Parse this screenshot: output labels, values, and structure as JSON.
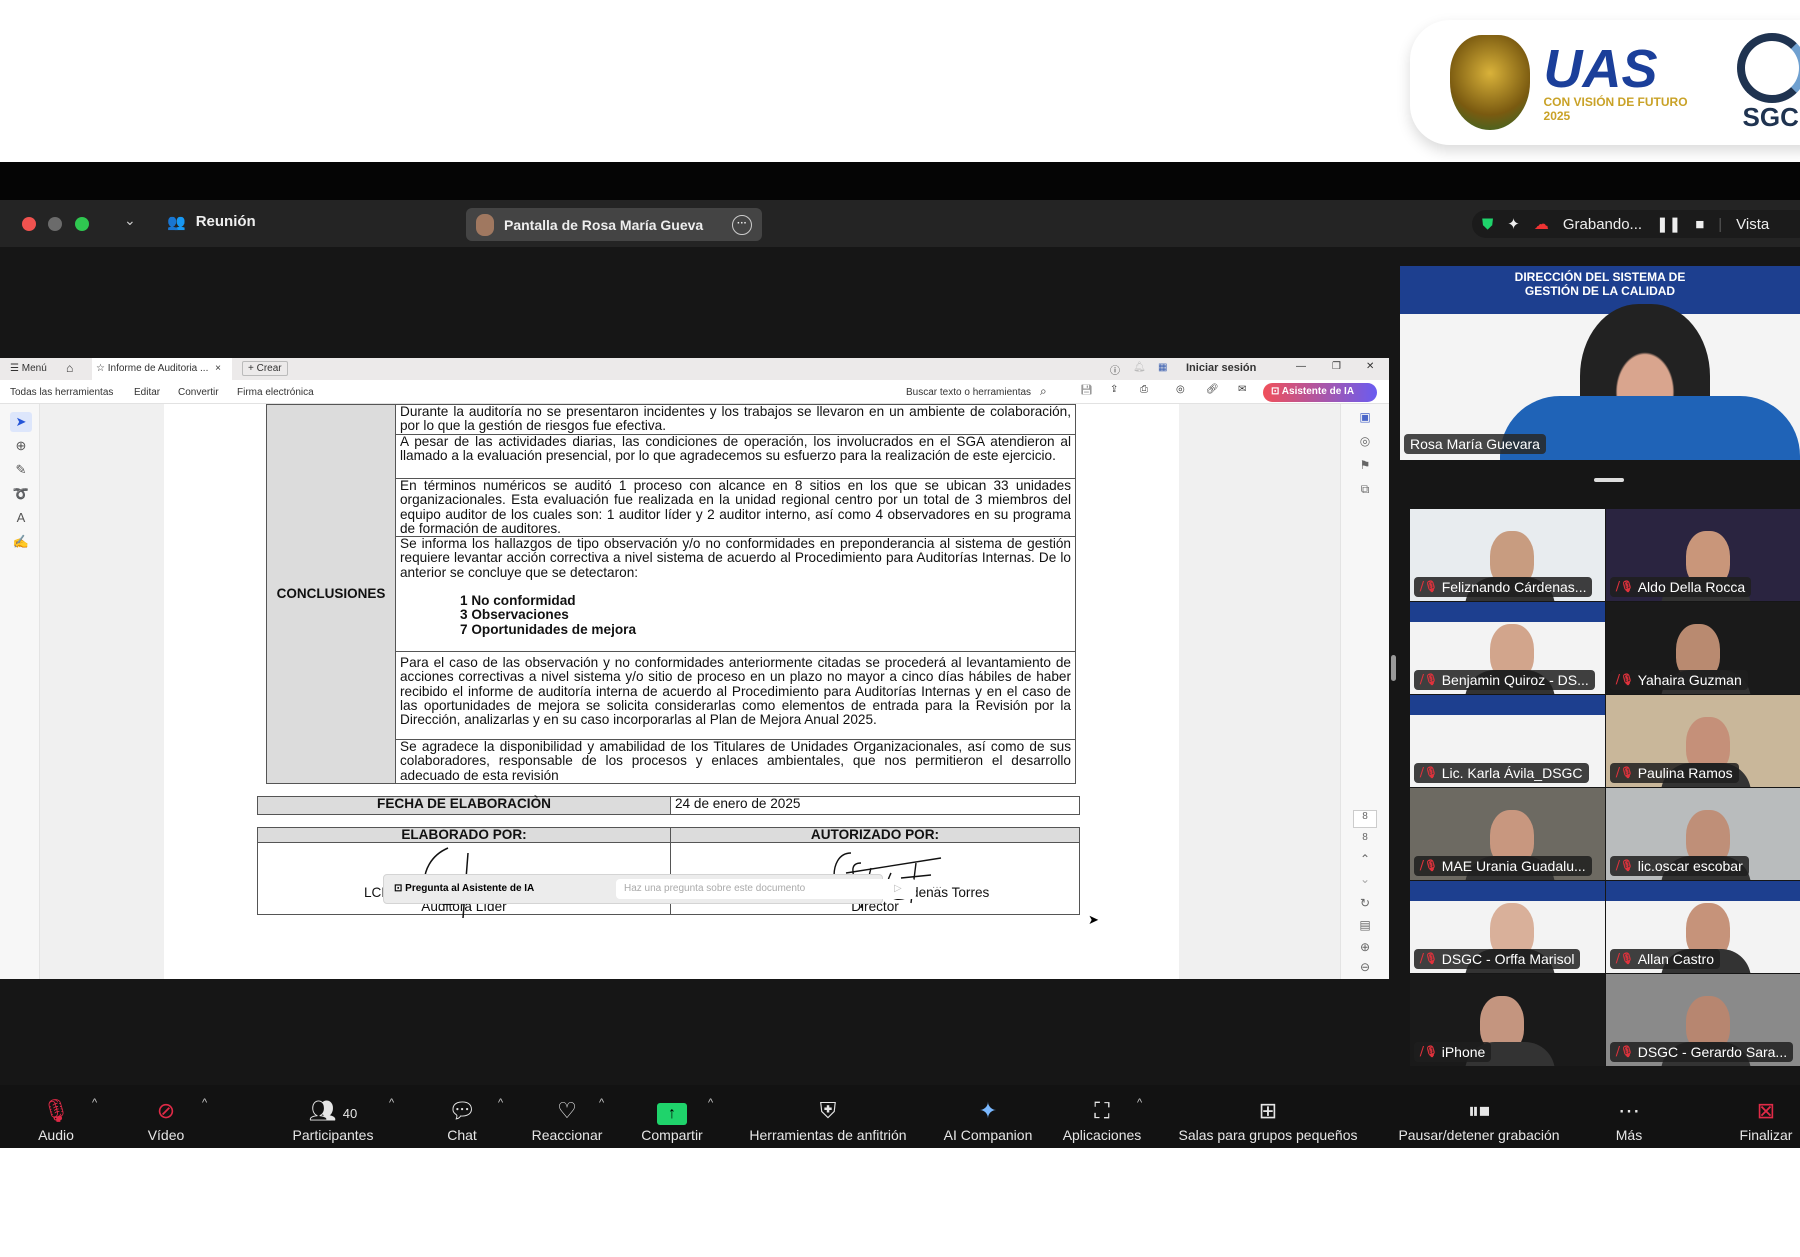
{
  "branding": {
    "uas": "UAS",
    "uas_tagline": "CON VISIÓN DE FUTURO 2025",
    "sgc": "SGC"
  },
  "zoom_top": {
    "meeting_label": "Reunión",
    "share_label": "Pantalla de Rosa María Gueva",
    "recording": "Grabando...",
    "view": "Vista"
  },
  "pdf": {
    "tabs": {
      "menu": "Menú",
      "doc_tab": "Informe de Auditoria ...",
      "create": "Crear"
    },
    "signin": "Iniciar sesión",
    "menu_items": [
      "Todas las herramientas",
      "Editar",
      "Convertir",
      "Firma electrónica"
    ],
    "search_placeholder": "Buscar texto o herramientas",
    "ai_button": "Asistente de IA",
    "ai_bar": {
      "label": "Pregunta al Asistente de IA",
      "placeholder": "Haz una pregunta sobre este documento",
      "more": "···"
    },
    "page_current": "8",
    "page_total": "8"
  },
  "document": {
    "section_label": "CONCLUSIONES",
    "paragraphs": [
      "Durante la auditoría no se presentaron incidentes y los trabajos se llevaron en un ambiente de colaboración, por lo que la gestión de riesgos fue efectiva.",
      "A pesar de las actividades diarias, las condiciones de operación, los involucrados en el SGA atendieron al llamado a la evaluación presencial, por lo que agradecemos su esfuerzo para la realización de este ejercicio.",
      "En términos numéricos se auditó 1 proceso con alcance en 8 sitios en los que se ubican 33 unidades organizacionales. Esta evaluación fue realizada en la unidad regional centro por un total de 3 miembros del equipo auditor de los cuales son: 1 auditor líder y 2 auditor interno, así como 4 observadores en su programa de formación de auditores.",
      "Se informa los hallazgos de tipo observación y/o no conformidades en preponderancia al sistema de gestión requiere levantar acción correctiva a nivel sistema de acuerdo al Procedimiento para Auditorías Internas. De lo anterior se concluye que se detectaron:",
      "Para el caso de las observación y no conformidades anteriormente citadas se procederá al levantamiento de acciones correctivas a nivel sistema y/o sitio de proceso en un plazo no mayor a cinco días hábiles de haber recibido el informe de auditoría interna de acuerdo al Procedimiento para Auditorías Internas y en el caso de las oportunidades de mejora se solicita considerarlas como elementos de entrada para la Revisión por la Dirección, analizarlas y en su caso incorporarlas al Plan de Mejora Anual 2025.",
      "Se agradece la disponibilidad y amabilidad de los Titulares de Unidades Organizacionales, así como de sus colaboradores, responsable de los procesos y enlaces ambientales, que nos permitieron el desarrollo adecuado de esta revisión"
    ],
    "findings": [
      "1 No conformidad",
      "3 Observaciones",
      "7 Oportunidades de mejora"
    ],
    "date_label": "FECHA DE ELABORACIÒN",
    "date_value": "24 de enero de 2025",
    "prepared_label": "ELABORADO POR:",
    "approved_label": "AUTORIZADO POR:",
    "prepared_name": "LCP. Rosa María Guevara Salido",
    "prepared_role": "Auditora Líder",
    "approved_name": "Dr. Feliznando Isidro Cárdenas Torres",
    "approved_role": "Director"
  },
  "speaker": {
    "name": "Rosa María Guevara",
    "banner_line1": "DIRECCIÓN DEL SISTEMA DE",
    "banner_line2": "GESTIÓN DE LA CALIDAD"
  },
  "participants": [
    {
      "name": "Feliznando Cárdenas..."
    },
    {
      "name": "Aldo Della Rocca"
    },
    {
      "name": "Benjamin Quiroz - DS..."
    },
    {
      "name": "Yahaira Guzman"
    },
    {
      "name": "Lic. Karla Ávila_DSGC"
    },
    {
      "name": "Paulina Ramos"
    },
    {
      "name": "MAE Urania Guadalu..."
    },
    {
      "name": "lic.oscar escobar"
    },
    {
      "name": "DSGC - Orffa Marisol"
    },
    {
      "name": "Allan Castro"
    },
    {
      "name": "iPhone"
    },
    {
      "name": "DSGC - Gerardo Sara..."
    }
  ],
  "bottom_bar": {
    "audio": "Audio",
    "video": "Vídeo",
    "participants": "Participantes",
    "participants_count": "40",
    "chat": "Chat",
    "react": "Reaccionar",
    "share": "Compartir",
    "host_tools": "Herramientas de anfitrión",
    "ai": "AI Companion",
    "apps": "Aplicaciones",
    "breakout": "Salas para grupos pequeños",
    "record": "Pausar/detener grabación",
    "more": "Más",
    "end": "Finalizar"
  },
  "colors": {
    "share_green": "#1fd36b",
    "end_red": "#e02a47",
    "ai_gradient_start": "#f0505a",
    "ai_gradient_end": "#6a5cf0",
    "banner_blue": "#1d3f8f"
  }
}
